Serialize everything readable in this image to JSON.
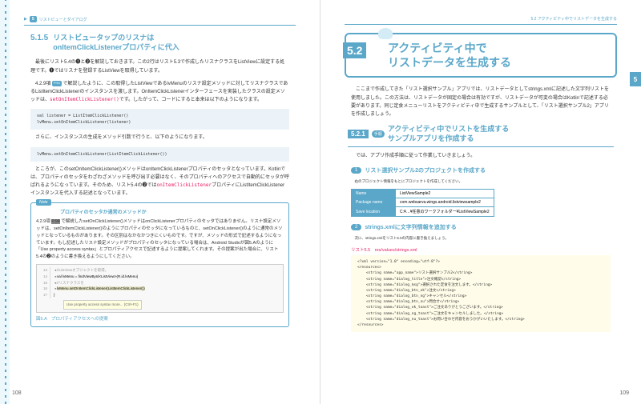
{
  "hdrL": {
    "num": "5",
    "txt": "リストビューとダイアログ"
  },
  "hdrR": "5.2 アクティビティ中でリストデータを生成する",
  "s515": {
    "num": "5.1.5",
    "ttl": "リストビュータップのリスナは\nonItemClickListenerプロパティに代入"
  },
  "p1": "最後にリスト5.4の❶と❷を解説しておきます。この2行はリスト5.3で作成したリスナクラスをListViewに設定する処理です。❶ではリスナを登録するListViewを取得しています。",
  "p2a": "4.2.9項",
  "p2badge": "P.94",
  "p2b": "で解説したように、この取得したListViewであるlvMenuのリスナ設定メソッドに対してリスナクラスであるListItemClickListenerのインスタンスを渡します。OnItemClickListenerインターフェースを実装したクラスの設定メソッドは、",
  "p2c": "setOnItemClickListener()",
  "p2d": "です。したがって、コードにすると本来は以下のようになります。",
  "code1": "val listener = ListItemClickListener()\nlvMenu.setOnItemClickListener(listener)",
  "p3": "さらに、インスタンスの生成をメソッド引数で行うと、以下のようになります。",
  "code2": "lvMenu.setOnItemClickListener(ListItemClickListener())",
  "p4a": "ところが、このsetOnItemClickListener()メソッドはonItemClickListenerプロパティのセッタとなっています。Kotlinでは、プロパティのセッタをわざわざメソッドを呼び出す必要はなく、そのプロパティへのアクセスで自動的にセッタが呼ばれるようになっています。そのため、リスト5.4の❷では",
  "p4b": "onItemClickListener",
  "p4c": "プロパティにListItemClickListenerインスタンスを代入する記述となっています。",
  "note": {
    "lbl": "Note",
    "ttl": "プロパティのセッタか通常のメソッドか",
    "b1a": "4.2.9項",
    "b1badge": "P.94",
    "b1b": "で解説したsetOnClickListener()メソッドはonClickListenerプロパティのセッタではありません。リスナ設定メソッドは、setOnItemClickListener()のようにプロパティのセッタになっているものと、setOnClickListener()のように通常のメソッドとなっているものがあります。その区別はなかなかつきにくいものです。ですが、メソッドの形式で記述するようになっています。もし記述したリスナ設定メソッドがプロパティのセッタになっている場合は、Android Studioが図5.Aのように「Use property access syntax」とプロパティアクセスで記述するように提案してくれます。その提案が出た場合に、リスト5.4の❷のように書き換えるようにしてください。"
  },
  "ide": {
    "l13a": "//ListViewオブジェクトを取得。",
    "l14": "val lvMenu = findViewById<ListView>(R.id.lvMenu)",
    "l15a": "//リスナクラスを",
    "l16": "lvMenu.setOnItemClickListener(ListItemClickListener())",
    "l17": "}",
    "hint": "Use property access syntax more... (Ctrl+F1)"
  },
  "figA": "図5.A　プロパティアクセスへの提案",
  "s52": {
    "num": "5.2",
    "ttl": "アクティビティ中で\nリストデータを生成する"
  },
  "p5": "ここまで作成してきた「リスト選択サンプル」アプリでは、リストデータとしてstrings.xmlに記述した文字列リストを使用しました。この方法は、リストデータが固定の場合は有効ですが、リストデータが可変の場合はKotlinで記述する必要があります。同じ定食メニューリストをアクティビティ中で生成するサンプルとして、「リスト選択サンプル2」アプリを作成しましょう。",
  "s521": {
    "num": "5.2.1",
    "badge": "手順",
    "ttl": "アクティビティ中でリストを生成する\nサンプルアプリを作成する"
  },
  "p6": "では、アプリ作成手順に従って作業していきましょう。",
  "step1": {
    "num": "1",
    "ttl": "リスト選択サンプル2のプロジェクトを作成する"
  },
  "p7": "右のプロジェクト情報をもとにプロジェクトを作成してください。",
  "tbl": [
    [
      "Name",
      "ListViewSample2"
    ],
    [
      "Package name",
      "com.websarva.wings.android.listviewsample2"
    ],
    [
      "Save location",
      "C:¥…¥任意のワークフォルダー¥ListViewSample2"
    ]
  ],
  "step2": {
    "num": "2",
    "ttl": "strings.xmlに文字列情報を追加する"
  },
  "p8": "次に、strings.xmlをリスト5.5の内容に書き換えましょう。",
  "listCap": "リスト5.5　res/values/strings.xml",
  "xml": "<?xml version=\"1.0\" encoding=\"utf-8\"?>\n<resources>\n    <string name=\"app_name\">リスト選択サンプル2</string>\n    <string name=\"dialog_title\">注文確認</string>\n    <string name=\"dialog_msg\">選択された定食を注文します。</string>\n    <string name=\"dialog_btn_ok\">注文</string>\n    <string name=\"dialog_btn_ng\">キャンセル</string>\n    <string name=\"dialog_btn_nu\">問合せ</string>\n    <string name=\"dialog_ok_toast\">ご注文ありがとうございます。</string>\n    <string name=\"dialog_ng_toast\">ご注文をキャンセルしました。</string>\n    <string name=\"dialog_nu_toast\">お問い合わせ内容をおうかがいいたします。</string>\n</resources>",
  "pgL": "108",
  "pgR": "109",
  "sideTab": "5"
}
